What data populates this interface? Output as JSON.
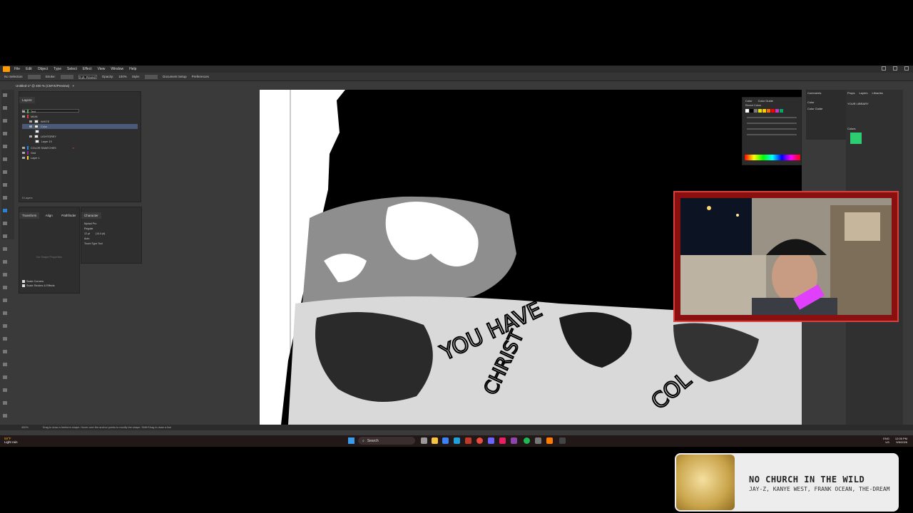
{
  "menubar": {
    "items": [
      "File",
      "Edit",
      "Object",
      "Type",
      "Select",
      "Effect",
      "View",
      "Window",
      "Help"
    ]
  },
  "controlbar": {
    "selection_label": "No Selection",
    "stroke_label": "Stroke:",
    "style_label": "Style:",
    "opacity_label": "Opacity:",
    "opacity_value": "100%",
    "brush_value": "3 pt. Round",
    "doc_setup": "Document Setup",
    "preferences": "Preferences"
  },
  "document_tab": {
    "title": "Untitled-1* @ 400 % (CMYK/Preview)"
  },
  "layers": {
    "tab": "Layers",
    "rows": [
      "Text",
      "MAIN",
      "WHITE",
      "Color",
      "LIGHTGREY",
      "Layer 19",
      "COLOR SWATCHES",
      "Grid",
      "Layer 1"
    ],
    "footer": "5 Layers"
  },
  "properties": {
    "tabs": [
      "Transform",
      "Align",
      "Pathfinder"
    ],
    "hint": "No Shape Properties",
    "scale_corners": "Scale Corners",
    "scale_strokes": "Scale Strokes & Effects"
  },
  "character": {
    "tab": "Character",
    "font": "Myriad Pro",
    "style": "Regular",
    "size": "12 pt",
    "leading": "(14.4 pt)",
    "tracking": "Auto",
    "touch_type": "Touch Type Tool"
  },
  "color_panel": {
    "tabs": [
      "Color",
      "Color Guide"
    ],
    "recent": "Recent Colors",
    "colors": [
      "#ffffff",
      "#000000",
      "#7a7a7a",
      "#e6e600",
      "#ffcc00",
      "#ff6600",
      "#ff0000",
      "#cc33cc",
      "#00aa66"
    ]
  },
  "comments": {
    "tabs": [
      "Comments",
      "Color",
      "Color Guide"
    ]
  },
  "libraries": {
    "tabs": [
      "Props",
      "Layers",
      "Libraries"
    ],
    "label": "YOUR LIBRARY",
    "colors_label": "Colors",
    "swatch_color": "#2ecc71"
  },
  "statusbar": {
    "zoom": "400%",
    "hint": "Drag to draw a freeform shape. Hover over the anchor points to modify the shape. Shift+Drag to draw a line"
  },
  "taskbar": {
    "weather_temp": "59°F",
    "weather_desc": "Light rain",
    "search": "Search",
    "lang": "ENG",
    "region": "US",
    "time": "12:05 PM",
    "date": "5/5/2026"
  },
  "nowplaying": {
    "title": "NO CHURCH IN THE WILD",
    "artist": "JAY-Z, KANYE WEST, FRANK OCEAN, THE-DREAM"
  },
  "artwork": {
    "text_1": "YOU HAVE",
    "text_2": "CHRIST",
    "text_3": "COL"
  }
}
